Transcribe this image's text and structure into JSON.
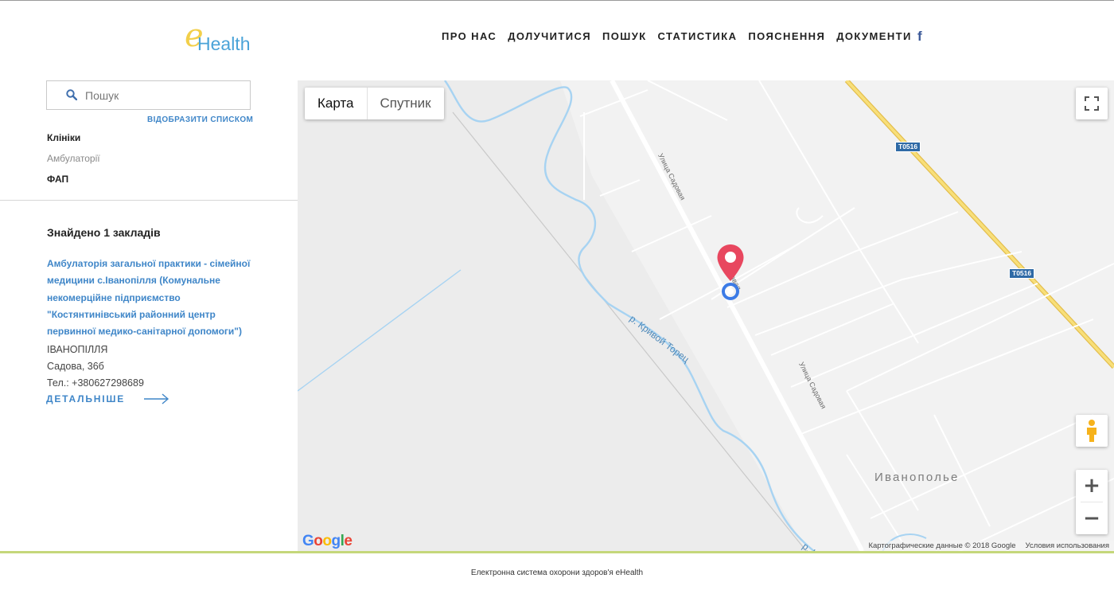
{
  "header": {
    "logo_e": "e",
    "logo_text": "Health",
    "nav": [
      "ПРО НАС",
      "ДОЛУЧИТИСЯ",
      "ПОШУК",
      "СТАТИСТИКА",
      "ПОЯСНЕННЯ",
      "ДОКУМЕНТИ"
    ],
    "facebook": "f"
  },
  "sidebar": {
    "search_placeholder": "Пошук",
    "list_view_link": "ВІДОБРАЗИТИ СПИСКОМ",
    "filters": [
      "Клініки",
      "Амбулаторії",
      "ФАП"
    ],
    "found_text": "Знайдено 1 закладів",
    "result": {
      "title": "Амбулаторія загальної практики - сімейної медицини с.Іванопілля (Комунальне некомерційне підприємство \"Костянтинівський районний центр первинної медико-санітарної допомоги\")",
      "city": "ІВАНОПІЛЛЯ",
      "address": "Садова, 36б",
      "phone": "Тел.: +380627298689",
      "details_link": "ДЕТАЛЬНІШЕ"
    }
  },
  "map": {
    "type_map": "Карта",
    "type_satellite": "Спутник",
    "zoom_in": "+",
    "zoom_out": "−",
    "town_label": "Иванополье",
    "street_labels": [
      "Улица Садовая",
      "Садовая",
      "Улица Садовая"
    ],
    "river_labels": [
      "р. Кривой Торец",
      "р. Кри"
    ],
    "road_shields": [
      "Т0516",
      "Т0516"
    ],
    "google_logo": "Google",
    "attribution": "Картографические данные © 2018 Google",
    "terms": "Условия использования",
    "colors": {
      "marker": "#e8475f",
      "location_dot": "#3c7be6",
      "river": "#a7d3f2",
      "highway": "#f5d76e",
      "accent_link": "#3f86c8",
      "footer_line": "#c5d77a"
    }
  },
  "footer": {
    "text": "Електронна система охорони здоров'я eHealth"
  }
}
